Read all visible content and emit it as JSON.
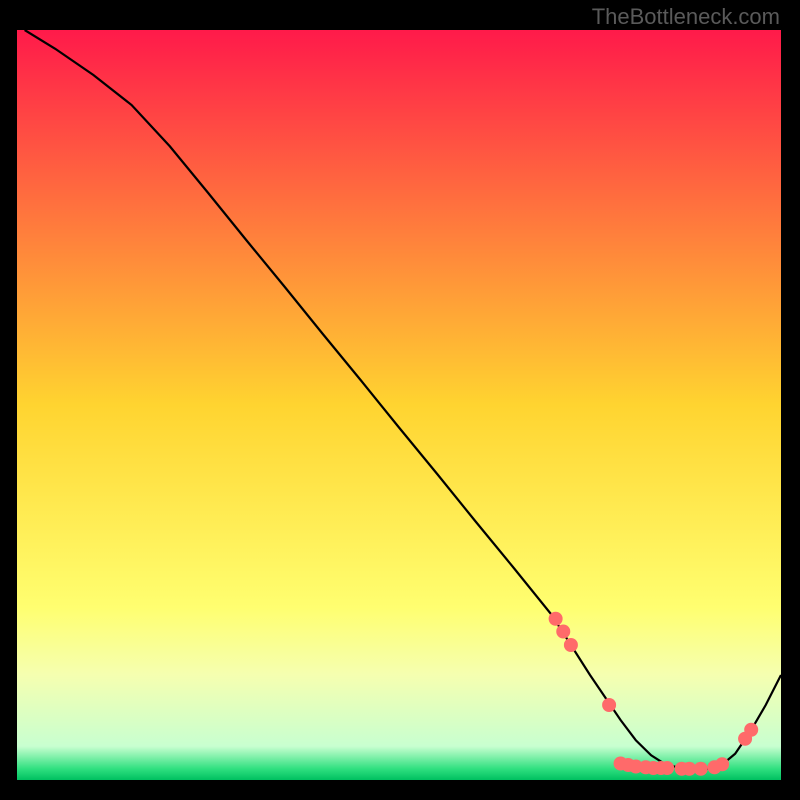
{
  "watermark": "TheBottleneck.com",
  "chart_data": {
    "type": "line",
    "title": "",
    "xlabel": "",
    "ylabel": "",
    "xlim": [
      0,
      100
    ],
    "ylim": [
      0,
      100
    ],
    "background_gradient": {
      "stops": [
        {
          "pos": 0.0,
          "color": "#ff1a4a"
        },
        {
          "pos": 0.5,
          "color": "#ffd430"
        },
        {
          "pos": 0.77,
          "color": "#ffff70"
        },
        {
          "pos": 0.86,
          "color": "#f5ffb0"
        },
        {
          "pos": 0.955,
          "color": "#c8ffd0"
        },
        {
          "pos": 0.985,
          "color": "#30e080"
        },
        {
          "pos": 1.0,
          "color": "#00c060"
        }
      ]
    },
    "series": [
      {
        "name": "bottleneck-curve",
        "color": "#000000",
        "x": [
          1,
          5,
          10,
          15,
          20,
          25,
          30,
          35,
          40,
          45,
          50,
          55,
          60,
          65,
          70,
          72.5,
          75,
          77,
          79,
          81,
          83,
          85,
          88,
          90,
          92,
          94,
          96,
          98,
          100
        ],
        "y": [
          100,
          97.5,
          94,
          90,
          84.5,
          78.3,
          72,
          65.8,
          59.5,
          53.3,
          47,
          40.8,
          34.5,
          28.3,
          22,
          18,
          14,
          11,
          8,
          5.3,
          3.3,
          2,
          1.4,
          1.4,
          1.8,
          3.5,
          6.5,
          10,
          14
        ]
      }
    ],
    "markers": {
      "name": "highlight-dots",
      "color": "#ff6a6a",
      "radius": 7,
      "points": [
        {
          "x": 70.5,
          "y": 21.5
        },
        {
          "x": 71.5,
          "y": 19.8
        },
        {
          "x": 72.5,
          "y": 18.0
        },
        {
          "x": 77.5,
          "y": 10.0
        },
        {
          "x": 79.0,
          "y": 2.2
        },
        {
          "x": 80.0,
          "y": 2.0
        },
        {
          "x": 81.0,
          "y": 1.8
        },
        {
          "x": 82.3,
          "y": 1.7
        },
        {
          "x": 83.3,
          "y": 1.6
        },
        {
          "x": 84.3,
          "y": 1.6
        },
        {
          "x": 85.1,
          "y": 1.6
        },
        {
          "x": 87.0,
          "y": 1.5
        },
        {
          "x": 88.0,
          "y": 1.5
        },
        {
          "x": 89.5,
          "y": 1.5
        },
        {
          "x": 91.3,
          "y": 1.7
        },
        {
          "x": 92.3,
          "y": 2.1
        },
        {
          "x": 95.3,
          "y": 5.5
        },
        {
          "x": 96.1,
          "y": 6.7
        }
      ]
    }
  }
}
